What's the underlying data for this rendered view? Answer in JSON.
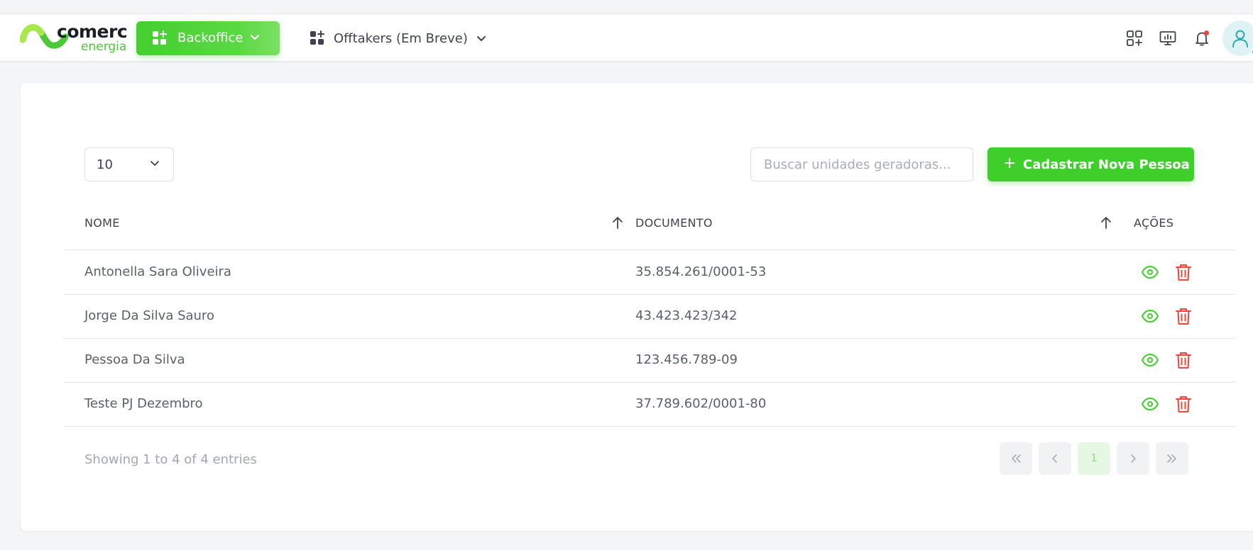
{
  "navbar": {
    "logo": {
      "word1": "comerc",
      "word2": "energia"
    },
    "backoffice_label": "Backoffice",
    "offtakers_label": "Offtakers (Em Breve)",
    "icons": [
      "apps-add-icon",
      "monitor-icon",
      "bell-icon",
      "user-icon"
    ],
    "colors": {
      "brand_green": "#44cf2f",
      "notification_dot": "#f0453a"
    }
  },
  "toolbar": {
    "per_page": "10",
    "search_placeholder": "Buscar unidades geradoras...",
    "new_button": "Cadastrar Nova Pessoa"
  },
  "table": {
    "columns": [
      "NOME",
      "DOCUMENTO",
      "AÇÕES"
    ],
    "rows": [
      {
        "nome": "Antonella Sara Oliveira",
        "documento": "35.854.261/0001-53"
      },
      {
        "nome": "Jorge Da Silva Sauro",
        "documento": "43.423.423/342"
      },
      {
        "nome": "Pessoa Da Silva",
        "documento": "123.456.789-09"
      },
      {
        "nome": "Teste PJ Dezembro",
        "documento": "37.789.602/0001-80"
      }
    ],
    "action_icons": [
      "eye-icon",
      "trash-icon"
    ],
    "action_colors": {
      "view": "#3fcf2a",
      "delete": "#f0453a"
    }
  },
  "footer": {
    "info": "Showing 1 to 4 of 4 entries",
    "current_page": "1"
  }
}
